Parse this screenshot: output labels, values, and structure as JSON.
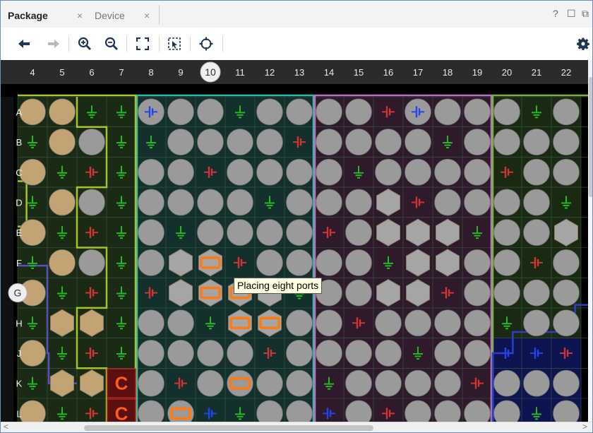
{
  "tabs": [
    {
      "label": "Package",
      "close": "×",
      "active": true
    },
    {
      "label": "Device",
      "close": "×",
      "active": false
    }
  ],
  "window_controls": {
    "help": "?",
    "restore": "☐",
    "float": "⧉"
  },
  "toolbar": {
    "back_icon": "arrow-left-icon",
    "forward_icon": "arrow-right-icon",
    "zoom_in_icon": "zoom-in-icon",
    "zoom_out_icon": "zoom-out-icon",
    "fit_icon": "zoom-fit-icon",
    "zoom_area_icon": "zoom-area-icon",
    "auto_fit_icon": "crosshair-icon",
    "settings_icon": "gear-icon"
  },
  "package_view": {
    "column_labels": [
      "4",
      "5",
      "6",
      "7",
      "8",
      "9",
      "10",
      "11",
      "12",
      "13",
      "14",
      "15",
      "16",
      "17",
      "18",
      "19",
      "20",
      "21",
      "22"
    ],
    "highlighted_column": "10",
    "row_labels": [
      "A",
      "B",
      "C",
      "D",
      "E",
      "F",
      "G",
      "H",
      "J",
      "K",
      "L"
    ],
    "highlighted_row": "G",
    "legend": {
      "ground": "ground-pin-icon",
      "power": "power-pin-icon",
      "io": "io-pin",
      "clock_label": "C"
    },
    "cells": [
      [
        "o",
        "o",
        "g",
        "g",
        "p:b",
        "o",
        "o",
        "g",
        "o",
        "o",
        "o",
        "o",
        "p:r",
        "p:b",
        "o",
        "o",
        "o",
        "g",
        "o"
      ],
      [
        "g",
        "o",
        "o",
        "g",
        "g",
        "o",
        "o",
        "o",
        "o",
        "p:r",
        "o",
        "o",
        "o",
        "o",
        "g",
        "o",
        "o",
        "o",
        "o"
      ],
      [
        "o",
        "g",
        "p:r",
        "g",
        "o",
        "o",
        "p:r",
        "o",
        "o",
        "o",
        "o",
        "g",
        "o",
        "o",
        "o",
        "o",
        "p:r",
        "o",
        "o"
      ],
      [
        "g",
        "o",
        "o",
        "g",
        "o",
        "o",
        "o",
        "o",
        "g",
        "o",
        "o",
        "o",
        "h",
        "p:r",
        "o",
        "o",
        "o",
        "o",
        "g"
      ],
      [
        "o",
        "g",
        "p:r",
        "g",
        "o",
        "g",
        "o",
        "o",
        "o",
        "o",
        "p:r",
        "o",
        "h",
        "h",
        "h",
        "g",
        "o",
        "o",
        "h"
      ],
      [
        "g",
        "o",
        "o",
        "g",
        "o",
        "h",
        "hs",
        "p:r",
        "o",
        "o",
        "o",
        "o",
        "g",
        "h",
        "h",
        "o",
        "o",
        "p:r",
        "o"
      ],
      [
        "o",
        "g",
        "p:r",
        "g",
        "p:r",
        "h",
        "hs",
        "hs",
        "h",
        "g",
        "o",
        "o",
        "h",
        "h",
        "p:r",
        "o",
        "o",
        "o",
        "o"
      ],
      [
        "g",
        "h",
        "h",
        "g",
        "o",
        "o",
        "g",
        "hs",
        "hs",
        "o",
        "o",
        "p:r",
        "o",
        "o",
        "o",
        "o",
        "g",
        "o",
        "o"
      ],
      [
        "o",
        "g",
        "p:r",
        "g",
        "o",
        "o",
        "o",
        "o",
        "p:r",
        "o",
        "o",
        "o",
        "o",
        "g",
        "o",
        "o",
        "p:b",
        "p:b",
        "p:r"
      ],
      [
        "g",
        "h",
        "h",
        "C",
        "o",
        "p:r",
        "o",
        "s",
        "o",
        "o",
        "g",
        "o",
        "o",
        "o",
        "o",
        "p:r",
        "o",
        "o",
        "o"
      ],
      [
        "o",
        "g",
        "p:r",
        "C",
        "o",
        "s",
        "p:b",
        "g",
        "o",
        "o",
        "p:b",
        "o",
        "p:r",
        "o",
        "o",
        "o",
        "o",
        "g",
        "o"
      ]
    ],
    "tooltip": "Placing eight ports",
    "colors": {
      "pin_gray": "#9a9a9a",
      "pin_tan": "#c2a474",
      "ground": "#22bb22",
      "power_red": "#d33333",
      "power_blue": "#2244ee",
      "io_orange": "#ff7a10",
      "bank_teal": "#34b8a8",
      "bank_pink": "#c070c0",
      "bank_green": "#7cb342",
      "bank_blue": "#2b3fcc",
      "bank_lime": "#a6c22c"
    }
  }
}
